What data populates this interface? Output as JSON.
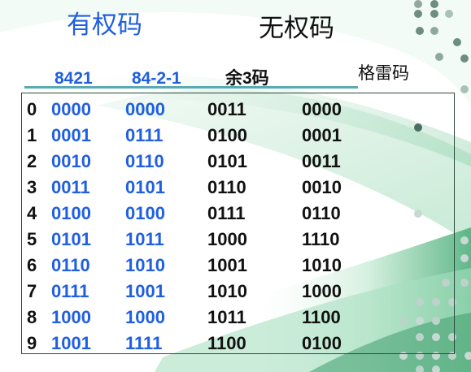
{
  "headings": {
    "weighted": "有权码",
    "unweighted": "无权码"
  },
  "columns": [
    "8421",
    "84-2-1",
    "余3码",
    "格雷码"
  ],
  "rows": [
    {
      "index": "0",
      "c8421": "0000",
      "c842m1": "0000",
      "excess3": "0011",
      "gray": "0000"
    },
    {
      "index": "1",
      "c8421": "0001",
      "c842m1": "0111",
      "excess3": "0100",
      "gray": "0001"
    },
    {
      "index": "2",
      "c8421": "0010",
      "c842m1": "0110",
      "excess3": "0101",
      "gray": "0011"
    },
    {
      "index": "3",
      "c8421": "0011",
      "c842m1": "0101",
      "excess3": "0110",
      "gray": "0010"
    },
    {
      "index": "4",
      "c8421": "0100",
      "c842m1": "0100",
      "excess3": "0111",
      "gray": "0110"
    },
    {
      "index": "5",
      "c8421": "0101",
      "c842m1": "1011",
      "excess3": "1000",
      "gray": "1110"
    },
    {
      "index": "6",
      "c8421": "0110",
      "c842m1": "1010",
      "excess3": "1001",
      "gray": "1010"
    },
    {
      "index": "7",
      "c8421": "0111",
      "c842m1": "1001",
      "excess3": "1010",
      "gray": "1000"
    },
    {
      "index": "8",
      "c8421": "1000",
      "c842m1": "1000",
      "excess3": "1011",
      "gray": "1100"
    },
    {
      "index": "9",
      "c8421": "1001",
      "c842m1": "1111",
      "excess3": "1100",
      "gray": "0100"
    }
  ],
  "colors": {
    "weighted_blue": "#1f5fe0",
    "text_dark": "#111111",
    "accent_teal": "#5aa9b5",
    "swoosh_green": "#8fd3a8"
  }
}
